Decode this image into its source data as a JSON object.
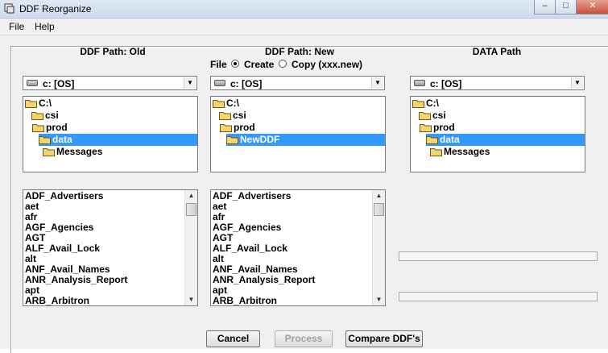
{
  "window": {
    "title": "DDF Reorganize",
    "minimize": "–",
    "maximize": "□",
    "close": "✕"
  },
  "menu": {
    "file": "File",
    "help": "Help"
  },
  "old": {
    "header": "DDF Path: Old",
    "drive": "c: [OS]",
    "dirs": [
      "C:\\",
      "csi",
      "prod",
      "data",
      "Messages"
    ],
    "files": [
      "ADF_Advertisers",
      "aet",
      "afr",
      "AGF_Agencies",
      "AGT",
      "ALF_Avail_Lock",
      "alt",
      "ANF_Avail_Names",
      "ANR_Analysis_Report",
      "apt",
      "ARB_Arbitron"
    ]
  },
  "new": {
    "header": "DDF Path: New",
    "file_label": "File",
    "create_label": "Create",
    "copy_label": "Copy (xxx.new)",
    "mode_selected": "Create",
    "drive": "c: [OS]",
    "dirs": [
      "C:\\",
      "csi",
      "prod",
      "NewDDF"
    ],
    "files": [
      "ADF_Advertisers",
      "aet",
      "afr",
      "AGF_Agencies",
      "AGT",
      "ALF_Avail_Lock",
      "alt",
      "ANF_Avail_Names",
      "ANR_Analysis_Report",
      "apt",
      "ARB_Arbitron"
    ]
  },
  "data": {
    "header": "DATA Path",
    "drive": "c: [OS]",
    "dirs": [
      "C:\\",
      "csi",
      "prod",
      "data",
      "Messages"
    ]
  },
  "buttons": {
    "cancel": "Cancel",
    "process": "Process",
    "compare": "Compare DDF's"
  }
}
